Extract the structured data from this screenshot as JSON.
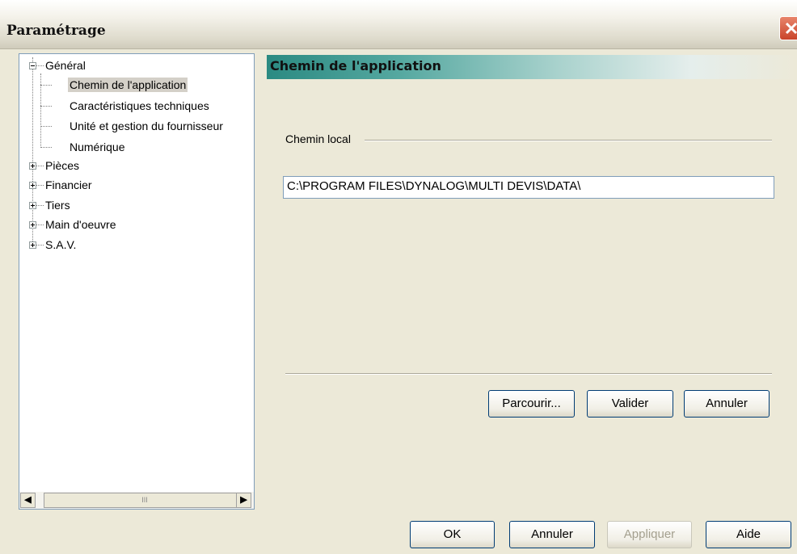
{
  "window": {
    "title": "Paramétrage"
  },
  "tree": {
    "groups": [
      {
        "label": "Général",
        "expanded": true,
        "children": [
          {
            "label": "Chemin de l'application",
            "selected": true
          },
          {
            "label": "Caractéristiques techniques"
          },
          {
            "label": "Unité et gestion du fournisseur"
          },
          {
            "label": "Numérique"
          }
        ]
      },
      {
        "label": "Pièces",
        "expanded": false
      },
      {
        "label": "Financier",
        "expanded": false
      },
      {
        "label": "Tiers",
        "expanded": false
      },
      {
        "label": "Main d'oeuvre",
        "expanded": false
      },
      {
        "label": "S.A.V.",
        "expanded": false
      }
    ],
    "scroll_thumb_grip": "III"
  },
  "panel": {
    "header": "Chemin de l'application",
    "group_label": "Chemin local",
    "path_value": "C:\\PROGRAM FILES\\DYNALOG\\MULTI DEVIS\\DATA\\",
    "buttons": {
      "browse": "Parcourir...",
      "validate": "Valider",
      "cancel": "Annuler"
    }
  },
  "footer": {
    "ok": "OK",
    "cancel": "Annuler",
    "apply": "Appliquer",
    "help": "Aide"
  },
  "colors": {
    "header_accent": "#2b8a82",
    "close_button": "#d9583b",
    "selection": "#d4d0c8"
  }
}
